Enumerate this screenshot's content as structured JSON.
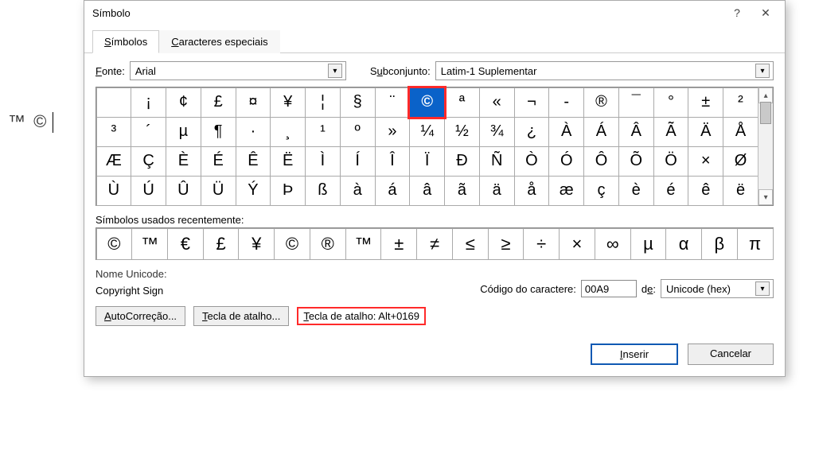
{
  "document_preview": "™  ©",
  "dialog": {
    "title": "Símbolo",
    "help_tooltip": "?",
    "close_tooltip": "✕",
    "tabs": {
      "symbols": "Símbolos",
      "special": "Caracteres especiais"
    },
    "font_label": "Fonte:",
    "font_value": "Arial",
    "subset_label": "Subconjunto:",
    "subset_value": "Latim-1 Suplementar",
    "grid_rows": [
      [
        " ",
        "¡",
        "¢",
        "£",
        "¤",
        "¥",
        "¦",
        "§",
        "¨",
        "©",
        "ª",
        "«",
        "¬",
        "-",
        "®",
        "¯",
        "°",
        "±",
        "²"
      ],
      [
        "³",
        "´",
        "µ",
        "¶",
        "·",
        "¸",
        "¹",
        "º",
        "»",
        "¼",
        "½",
        "¾",
        "¿",
        "À",
        "Á",
        "Â",
        "Ã",
        "Ä",
        "Å"
      ],
      [
        "Æ",
        "Ç",
        "È",
        "É",
        "Ê",
        "Ë",
        "Ì",
        "Í",
        "Î",
        "Ï",
        "Ð",
        "Ñ",
        "Ò",
        "Ó",
        "Ô",
        "Õ",
        "Ö",
        "×",
        "Ø"
      ],
      [
        "Ù",
        "Ú",
        "Û",
        "Ü",
        "Ý",
        "Þ",
        "ß",
        "à",
        "á",
        "â",
        "ã",
        "ä",
        "å",
        "æ",
        "ç",
        "è",
        "é",
        "ê",
        "ë"
      ]
    ],
    "selected_char": "©",
    "recent_label": "Símbolos usados recentemente:",
    "recent": [
      "©",
      "™",
      "€",
      "£",
      "¥",
      "©",
      "®",
      "™",
      "±",
      "≠",
      "≤",
      "≥",
      "÷",
      "×",
      "∞",
      "µ",
      "α",
      "β",
      "π"
    ],
    "unicode_name_label": "Nome Unicode:",
    "unicode_name": "Copyright Sign",
    "char_code_label": "Código do caractere:",
    "char_code_value": "00A9",
    "from_label": "de:",
    "from_value": "Unicode (hex)",
    "autocorrect_btn": "AutoCorreção...",
    "shortcut_btn": "Tecla de atalho...",
    "shortcut_display": "Tecla de atalho: Alt+0169",
    "insert_btn": "Inserir",
    "cancel_btn": "Cancelar"
  }
}
